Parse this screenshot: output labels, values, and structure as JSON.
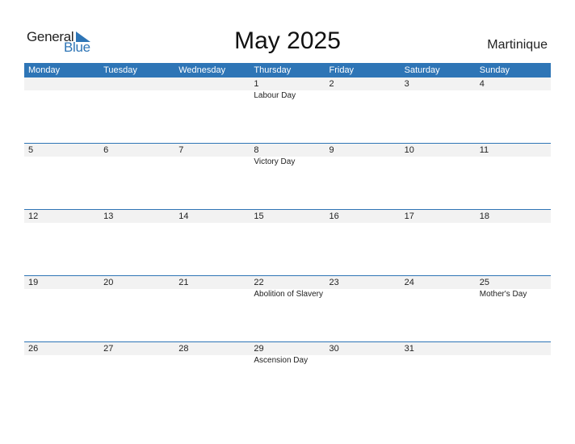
{
  "logo": {
    "general": "General",
    "blue": "Blue"
  },
  "title": "May 2025",
  "country": "Martinique",
  "weekdays": [
    "Monday",
    "Tuesday",
    "Wednesday",
    "Thursday",
    "Friday",
    "Saturday",
    "Sunday"
  ],
  "weeks": [
    [
      {
        "day": "",
        "holiday": ""
      },
      {
        "day": "",
        "holiday": ""
      },
      {
        "day": "",
        "holiday": ""
      },
      {
        "day": "1",
        "holiday": "Labour Day"
      },
      {
        "day": "2",
        "holiday": ""
      },
      {
        "day": "3",
        "holiday": ""
      },
      {
        "day": "4",
        "holiday": ""
      }
    ],
    [
      {
        "day": "5",
        "holiday": ""
      },
      {
        "day": "6",
        "holiday": ""
      },
      {
        "day": "7",
        "holiday": ""
      },
      {
        "day": "8",
        "holiday": "Victory Day"
      },
      {
        "day": "9",
        "holiday": ""
      },
      {
        "day": "10",
        "holiday": ""
      },
      {
        "day": "11",
        "holiday": ""
      }
    ],
    [
      {
        "day": "12",
        "holiday": ""
      },
      {
        "day": "13",
        "holiday": ""
      },
      {
        "day": "14",
        "holiday": ""
      },
      {
        "day": "15",
        "holiday": ""
      },
      {
        "day": "16",
        "holiday": ""
      },
      {
        "day": "17",
        "holiday": ""
      },
      {
        "day": "18",
        "holiday": ""
      }
    ],
    [
      {
        "day": "19",
        "holiday": ""
      },
      {
        "day": "20",
        "holiday": ""
      },
      {
        "day": "21",
        "holiday": ""
      },
      {
        "day": "22",
        "holiday": "Abolition of Slavery"
      },
      {
        "day": "23",
        "holiday": ""
      },
      {
        "day": "24",
        "holiday": ""
      },
      {
        "day": "25",
        "holiday": "Mother's Day"
      }
    ],
    [
      {
        "day": "26",
        "holiday": ""
      },
      {
        "day": "27",
        "holiday": ""
      },
      {
        "day": "28",
        "holiday": ""
      },
      {
        "day": "29",
        "holiday": "Ascension Day"
      },
      {
        "day": "30",
        "holiday": ""
      },
      {
        "day": "31",
        "holiday": ""
      },
      {
        "day": "",
        "holiday": ""
      }
    ]
  ],
  "colors": {
    "accent": "#2e75b6",
    "band": "#f2f2f2"
  }
}
